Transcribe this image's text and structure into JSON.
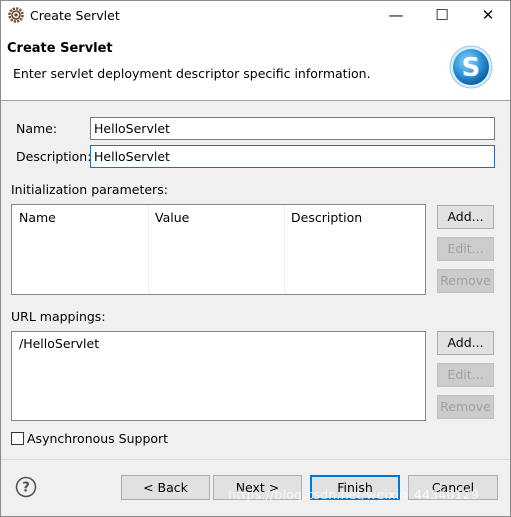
{
  "window": {
    "title": "Create Servlet",
    "minimize_glyph": "—",
    "maximize_glyph": "☐",
    "close_glyph": "✕"
  },
  "header": {
    "title": "Create Servlet",
    "description": "Enter servlet deployment descriptor specific information.",
    "logo_letter": "S"
  },
  "form": {
    "name_label": "Name:",
    "name_value": "HelloServlet",
    "description_label": "Description:",
    "description_value": "HelloServlet"
  },
  "init_params": {
    "label": "Initialization parameters:",
    "columns": [
      "Name",
      "Value",
      "Description"
    ],
    "add_label": "Add...",
    "edit_label": "Edit...",
    "remove_label": "Remove"
  },
  "url_mappings": {
    "label": "URL mappings:",
    "items": [
      "/HelloServlet"
    ],
    "add_label": "Add...",
    "edit_label": "Edit...",
    "remove_label": "Remove"
  },
  "async": {
    "label": "Asynchronous Support",
    "checked": false
  },
  "footer": {
    "help_glyph": "?",
    "back_label": "< Back",
    "next_label": "Next >",
    "finish_label": "Finish",
    "cancel_label": "Cancel"
  },
  "watermark": "https://blog.csdn.net/weixin_44340129",
  "colors": {
    "accent": "#0078d7",
    "logo_blue": "#1e88c8",
    "disabled_text": "#a0a0a0"
  }
}
